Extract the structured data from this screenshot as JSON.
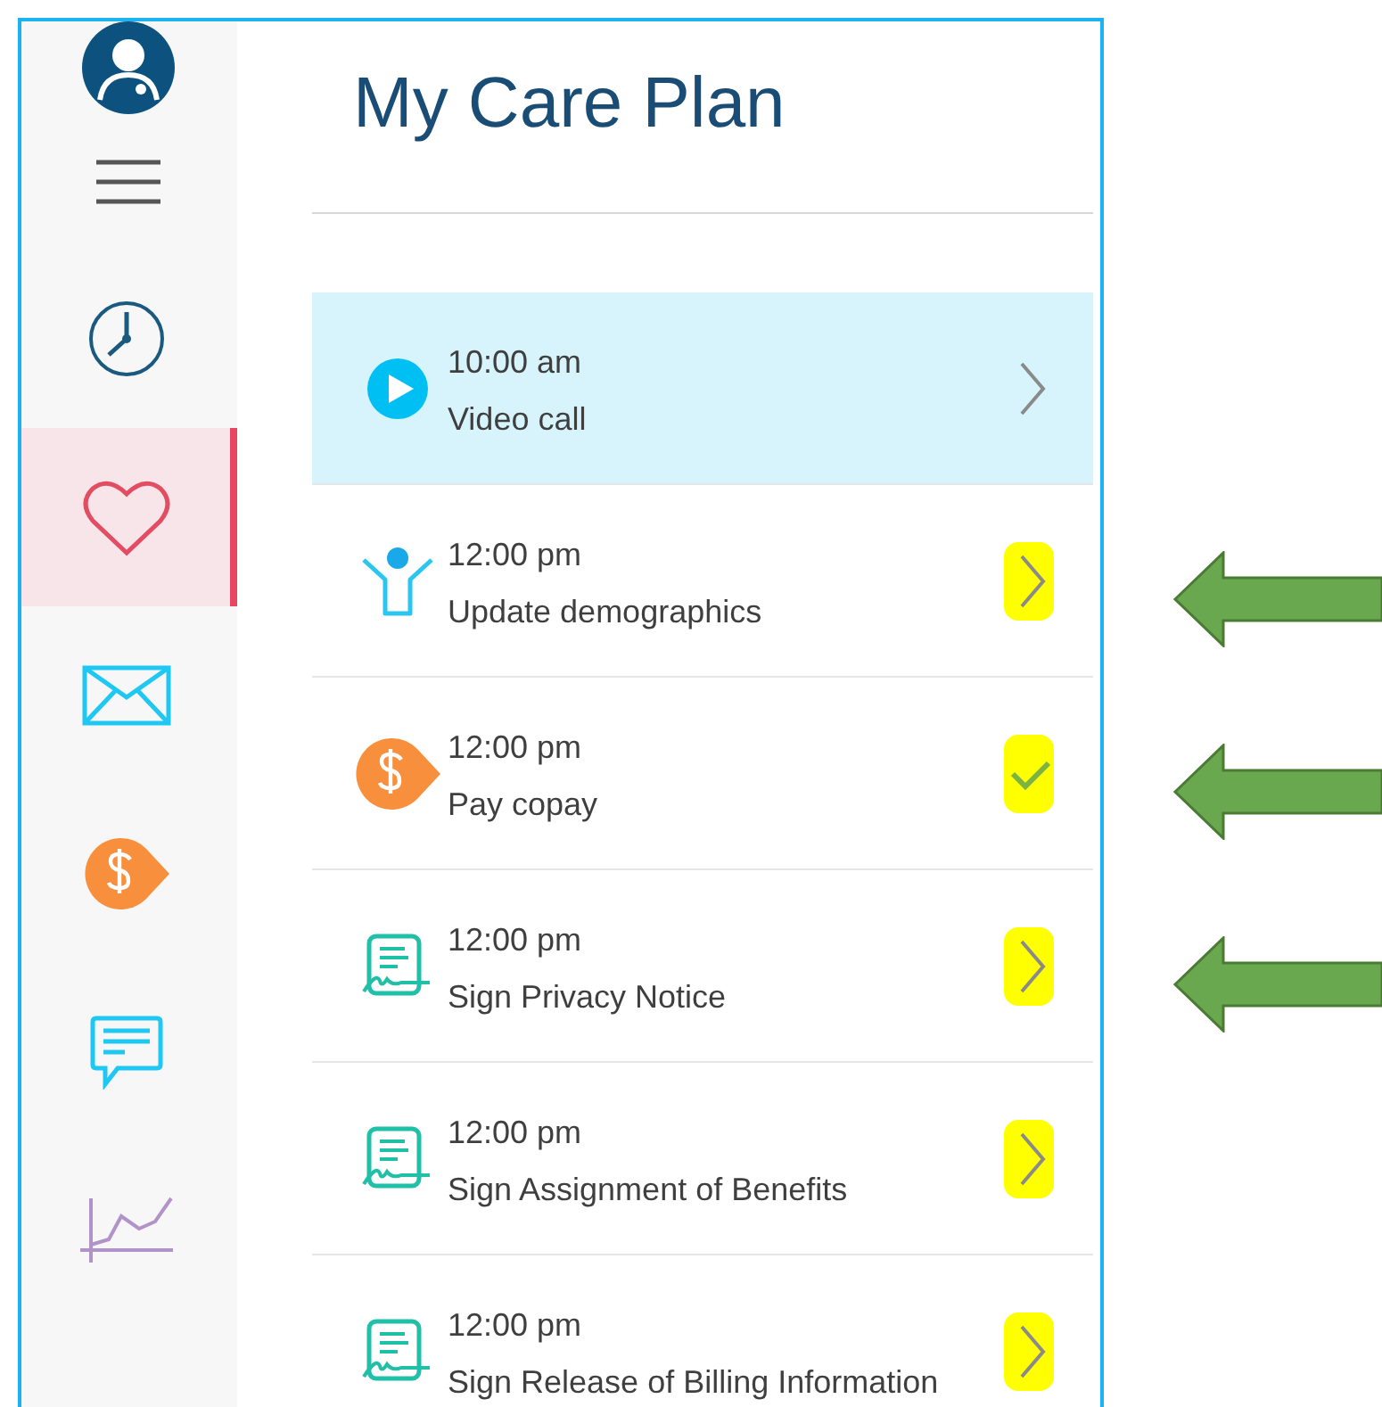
{
  "sidebar": {
    "items": [
      {
        "kind": "clock",
        "selected": false
      },
      {
        "kind": "heart",
        "selected": true
      },
      {
        "kind": "mail",
        "selected": false
      },
      {
        "kind": "payment",
        "selected": false
      },
      {
        "kind": "chat",
        "selected": false
      },
      {
        "kind": "chart",
        "selected": false
      }
    ]
  },
  "title": "My Care Plan",
  "tasks": [
    {
      "kind": "video",
      "time": "10:00 am",
      "title": "Video call",
      "selected": true,
      "completed": false,
      "highlighted": false,
      "annotated": false
    },
    {
      "kind": "person",
      "time": "12:00 pm",
      "title": "Update demographics",
      "selected": false,
      "completed": false,
      "highlighted": true,
      "annotated": true
    },
    {
      "kind": "payment",
      "time": "12:00 pm",
      "title": "Pay copay",
      "selected": false,
      "completed": true,
      "highlighted": true,
      "annotated": true
    },
    {
      "kind": "signature",
      "time": "12:00 pm",
      "title": "Sign Privacy Notice",
      "selected": false,
      "completed": false,
      "highlighted": true,
      "annotated": true
    },
    {
      "kind": "signature",
      "time": "12:00 pm",
      "title": "Sign Assignment of Benefits",
      "selected": false,
      "completed": false,
      "highlighted": true,
      "annotated": false
    },
    {
      "kind": "signature",
      "time": "12:00 pm",
      "title": "Sign Release of Billing Information",
      "selected": false,
      "completed": false,
      "highlighted": true,
      "annotated": false
    }
  ]
}
